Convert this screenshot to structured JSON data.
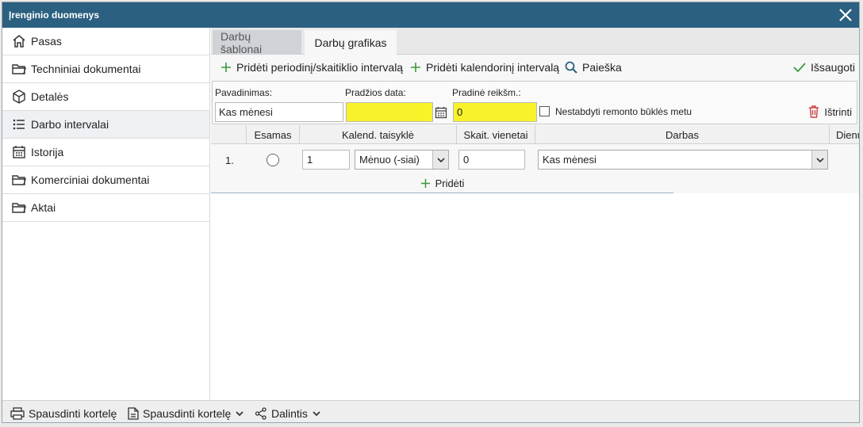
{
  "window": {
    "title": "Įrenginio duomenys"
  },
  "sidebar": {
    "items": [
      {
        "label": "Pasas",
        "icon": "home-icon"
      },
      {
        "label": "Techniniai dokumentai",
        "icon": "folder-icon"
      },
      {
        "label": "Detalės",
        "icon": "box-icon"
      },
      {
        "label": "Darbo intervalai",
        "icon": "list-icon"
      },
      {
        "label": "Istorija",
        "icon": "calendar-icon"
      },
      {
        "label": "Komerciniai dokumentai",
        "icon": "folder-icon"
      },
      {
        "label": "Aktai",
        "icon": "folder-icon"
      }
    ]
  },
  "tabs": [
    {
      "label": "Darbų šablonai"
    },
    {
      "label": "Darbų grafikas"
    }
  ],
  "toolbar": {
    "add_periodic": "Pridėti periodinį/skaitiklio intervalą",
    "add_calendar": "Pridėti kalendorinį intervalą",
    "search": "Paieška",
    "save": "Išsaugoti"
  },
  "filter": {
    "name_label": "Pavadinimas:",
    "name_value": "Kas mėnesi",
    "start_label": "Pradžios data:",
    "start_value": "",
    "initial_label": "Pradinė reikšm.:",
    "initial_value": "0",
    "checkbox_label": "Nestabdyti remonto būklės metu",
    "delete": "Ištrinti"
  },
  "grid": {
    "columns": [
      "Esamas",
      "Kalend. taisyklė",
      "Skait. vienetai",
      "Darbas",
      "Dienu"
    ],
    "rows": [
      {
        "num": "1.",
        "rule_value": "1",
        "rule_unit": "Mėnuo (-siai)",
        "units": "0",
        "work": "Kas mėnesi"
      }
    ],
    "add": "Pridėti"
  },
  "footer": {
    "print1": "Spausdinti kortelę",
    "print2": "Spausdinti kortelę",
    "share": "Dalintis"
  },
  "colors": {
    "titlebar": "#2b6080",
    "highlight": "#f8f22a",
    "add_green": "#3a9a3a",
    "delete_red": "#d04040"
  }
}
